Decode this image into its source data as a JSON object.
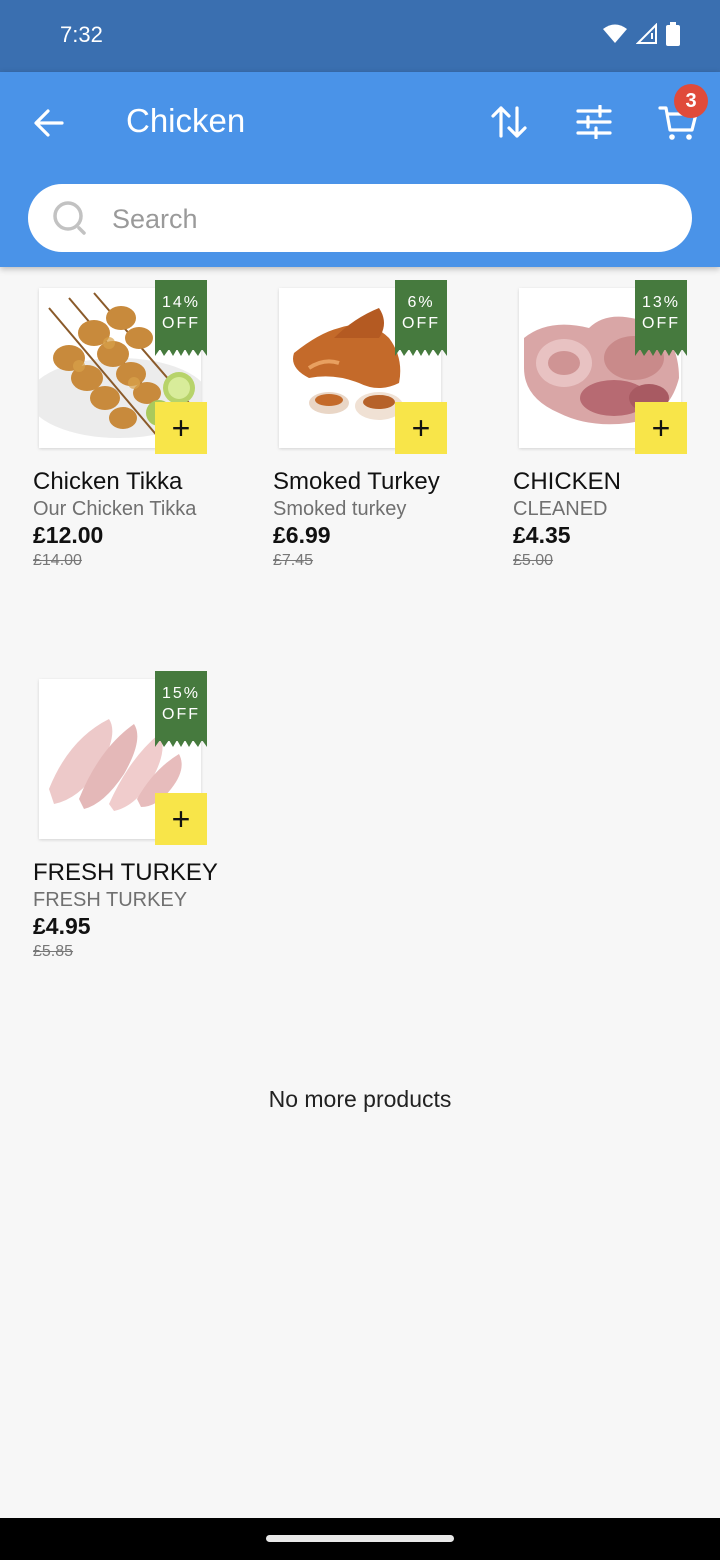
{
  "status": {
    "time": "7:32"
  },
  "header": {
    "title": "Chicken",
    "cart_count": "3"
  },
  "search": {
    "placeholder": "Search"
  },
  "products": [
    {
      "name": "Chicken Tikka",
      "subtitle": "Our Chicken Tikka",
      "price": "£12.00",
      "old_price": "£14.00",
      "discount": "14%",
      "discount_suffix": "OFF"
    },
    {
      "name": "Smoked Turkey",
      "subtitle": "Smoked turkey",
      "price": "£6.99",
      "old_price": "£7.45",
      "discount": "6%",
      "discount_suffix": "OFF"
    },
    {
      "name": "CHICKEN",
      "subtitle": "CLEANED",
      "price": "£4.35",
      "old_price": "£5.00",
      "discount": "13%",
      "discount_suffix": "OFF"
    },
    {
      "name": "FRESH TURKEY",
      "subtitle": "FRESH TURKEY",
      "price": "£4.95",
      "old_price": "£5.85",
      "discount": "15%",
      "discount_suffix": "OFF"
    }
  ],
  "footer": {
    "no_more": "No more products"
  },
  "colors": {
    "appbar": "#4a93e8",
    "statusbar": "#3a6fb0",
    "tag": "#467a3e",
    "add": "#f8e549",
    "badge": "#e04b3a"
  }
}
